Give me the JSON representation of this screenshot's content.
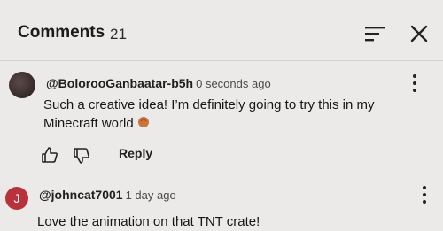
{
  "header": {
    "title": "Comments",
    "count": "21"
  },
  "comments": [
    {
      "author": "@BolorooGanbaatar-b5h",
      "time": "0 seconds ago",
      "text_line1": "Such a creative idea! I’m definitely going to try this in my",
      "text_line2": "Minecraft world",
      "emoji": "clapping-hands-emoji"
    },
    {
      "author": "@johncat7001",
      "time": "1 day ago",
      "avatar_letter": "J",
      "text": "Love the animation on that TNT crate!"
    }
  ],
  "actions": {
    "reply_label": "Reply"
  },
  "colors": {
    "avatar_j": "#b8323c",
    "background": "#eceae8"
  }
}
